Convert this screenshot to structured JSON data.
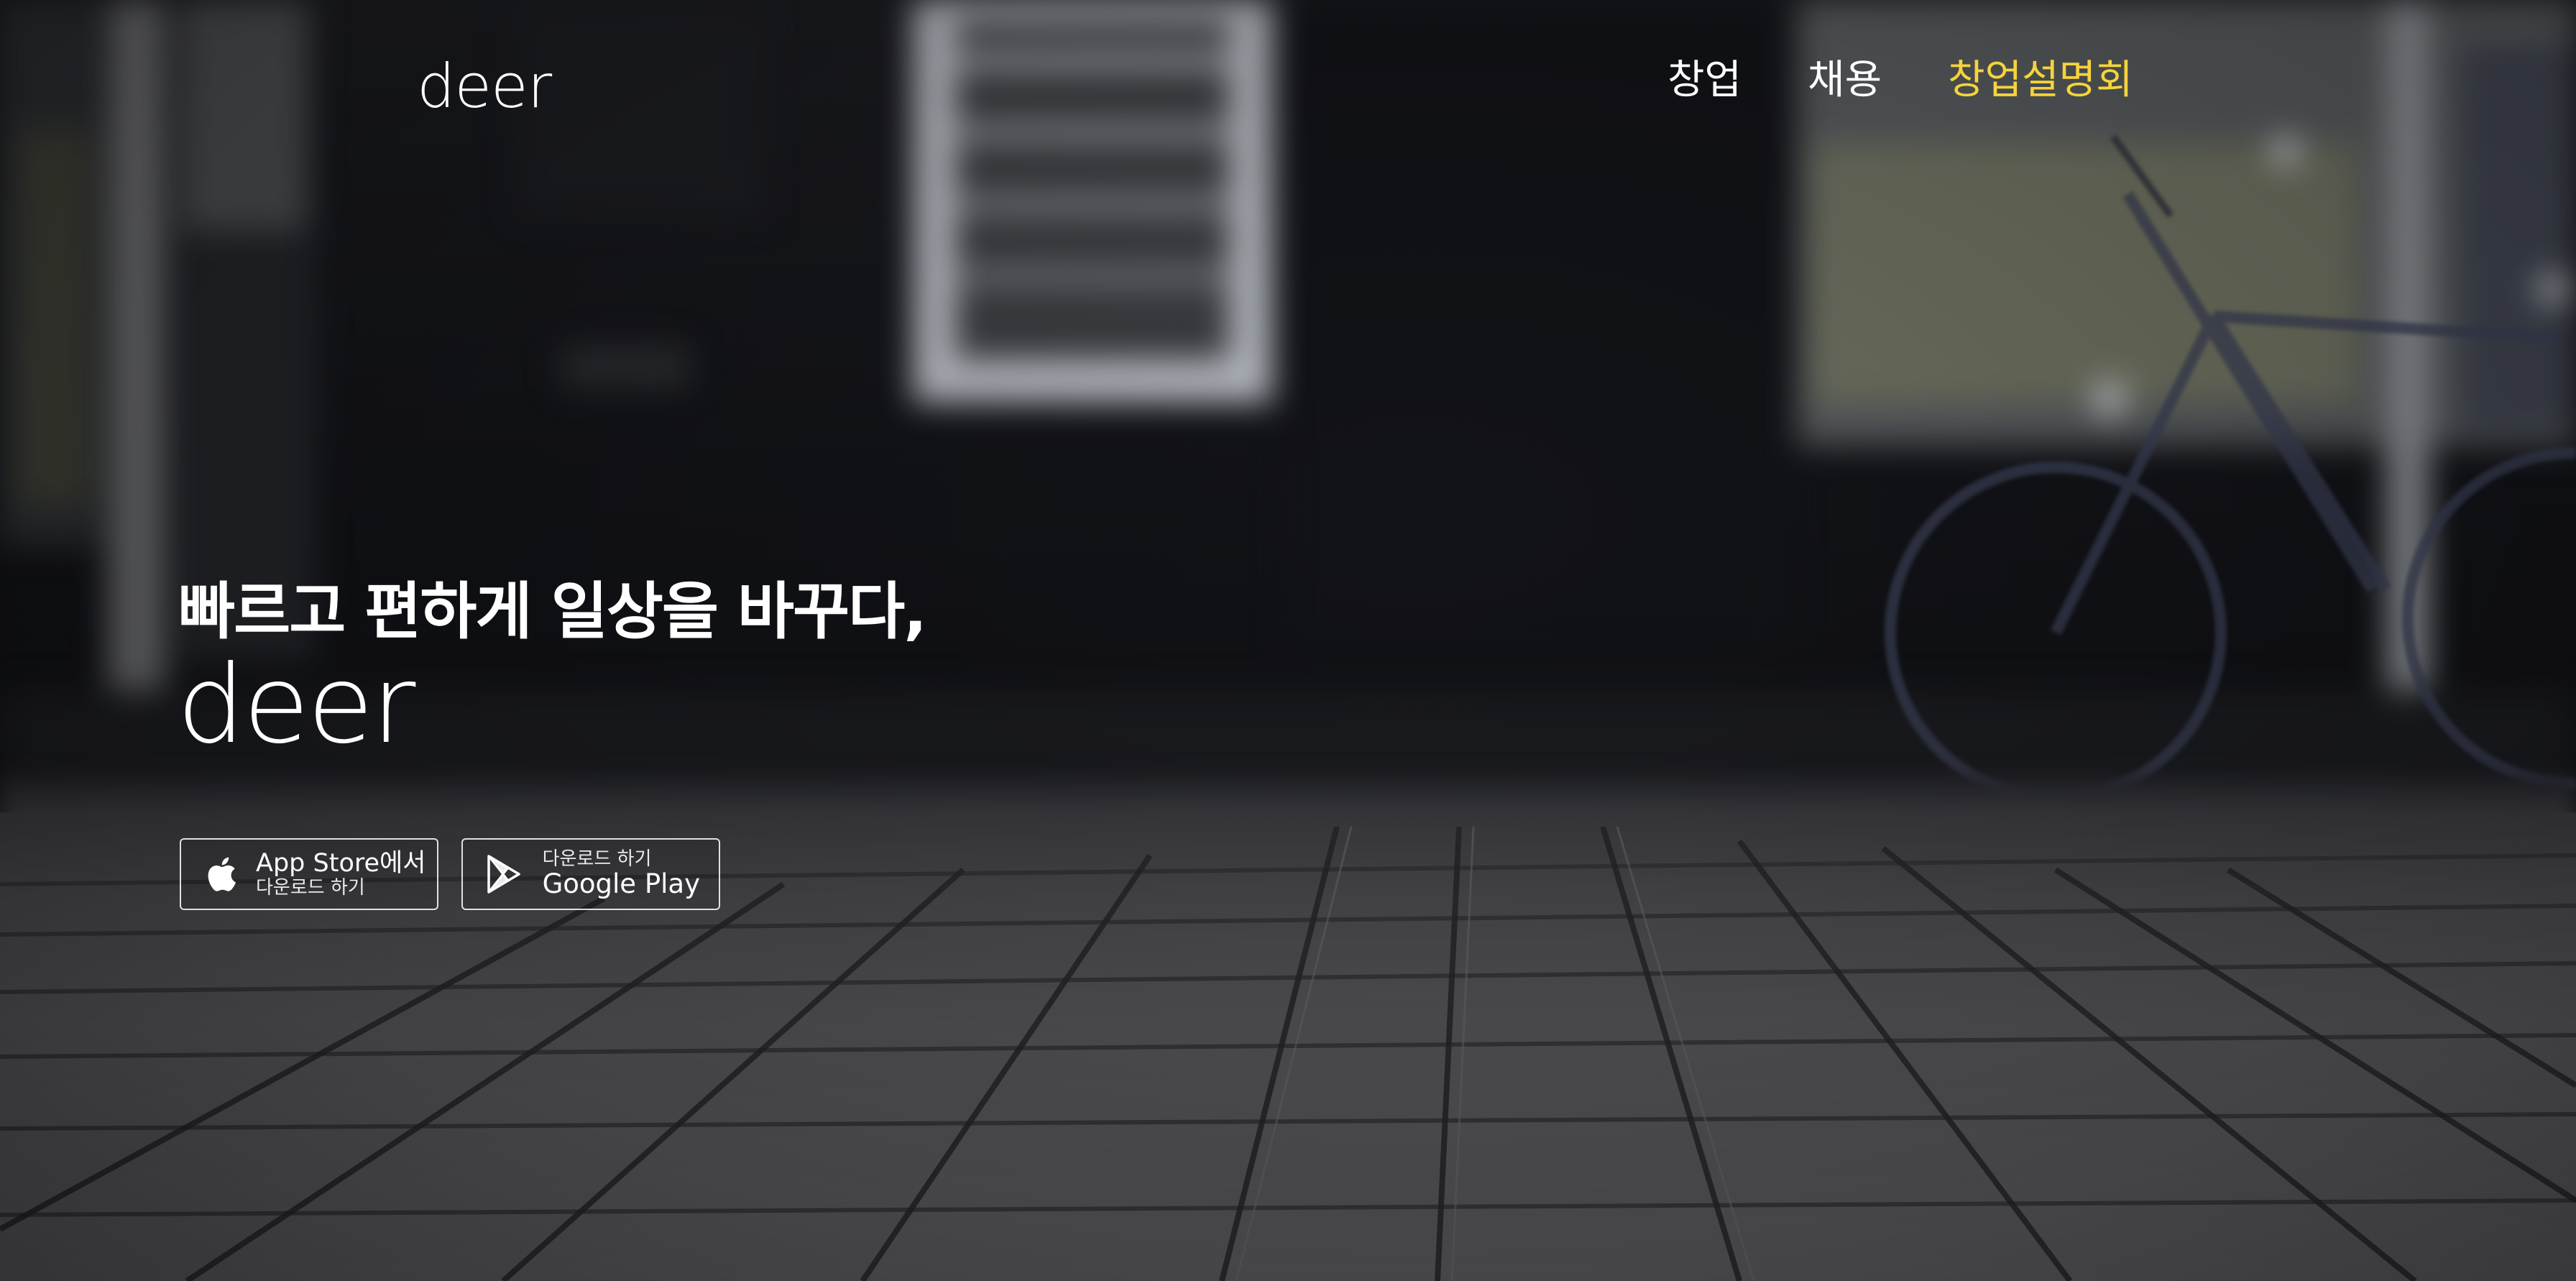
{
  "brand": {
    "logo_small": "deer",
    "logo_large": "deer"
  },
  "nav": {
    "items": [
      {
        "label": "창업"
      },
      {
        "label": "채용"
      },
      {
        "label": "창업설명회",
        "active": true
      }
    ],
    "active_color": "#f5d33c"
  },
  "hero": {
    "headline": "빠르고 편하게 일상을 바꾸다,"
  },
  "stores": {
    "apple": {
      "main": "App Store에서",
      "sub": "다운로드 하기",
      "icon": "apple-icon"
    },
    "google": {
      "sub": "다운로드 하기",
      "main": "Google Play",
      "icon": "google-play-icon"
    }
  },
  "colors": {
    "text": "#ffffff",
    "accent": "#f5d33c",
    "background": "#16161a"
  }
}
